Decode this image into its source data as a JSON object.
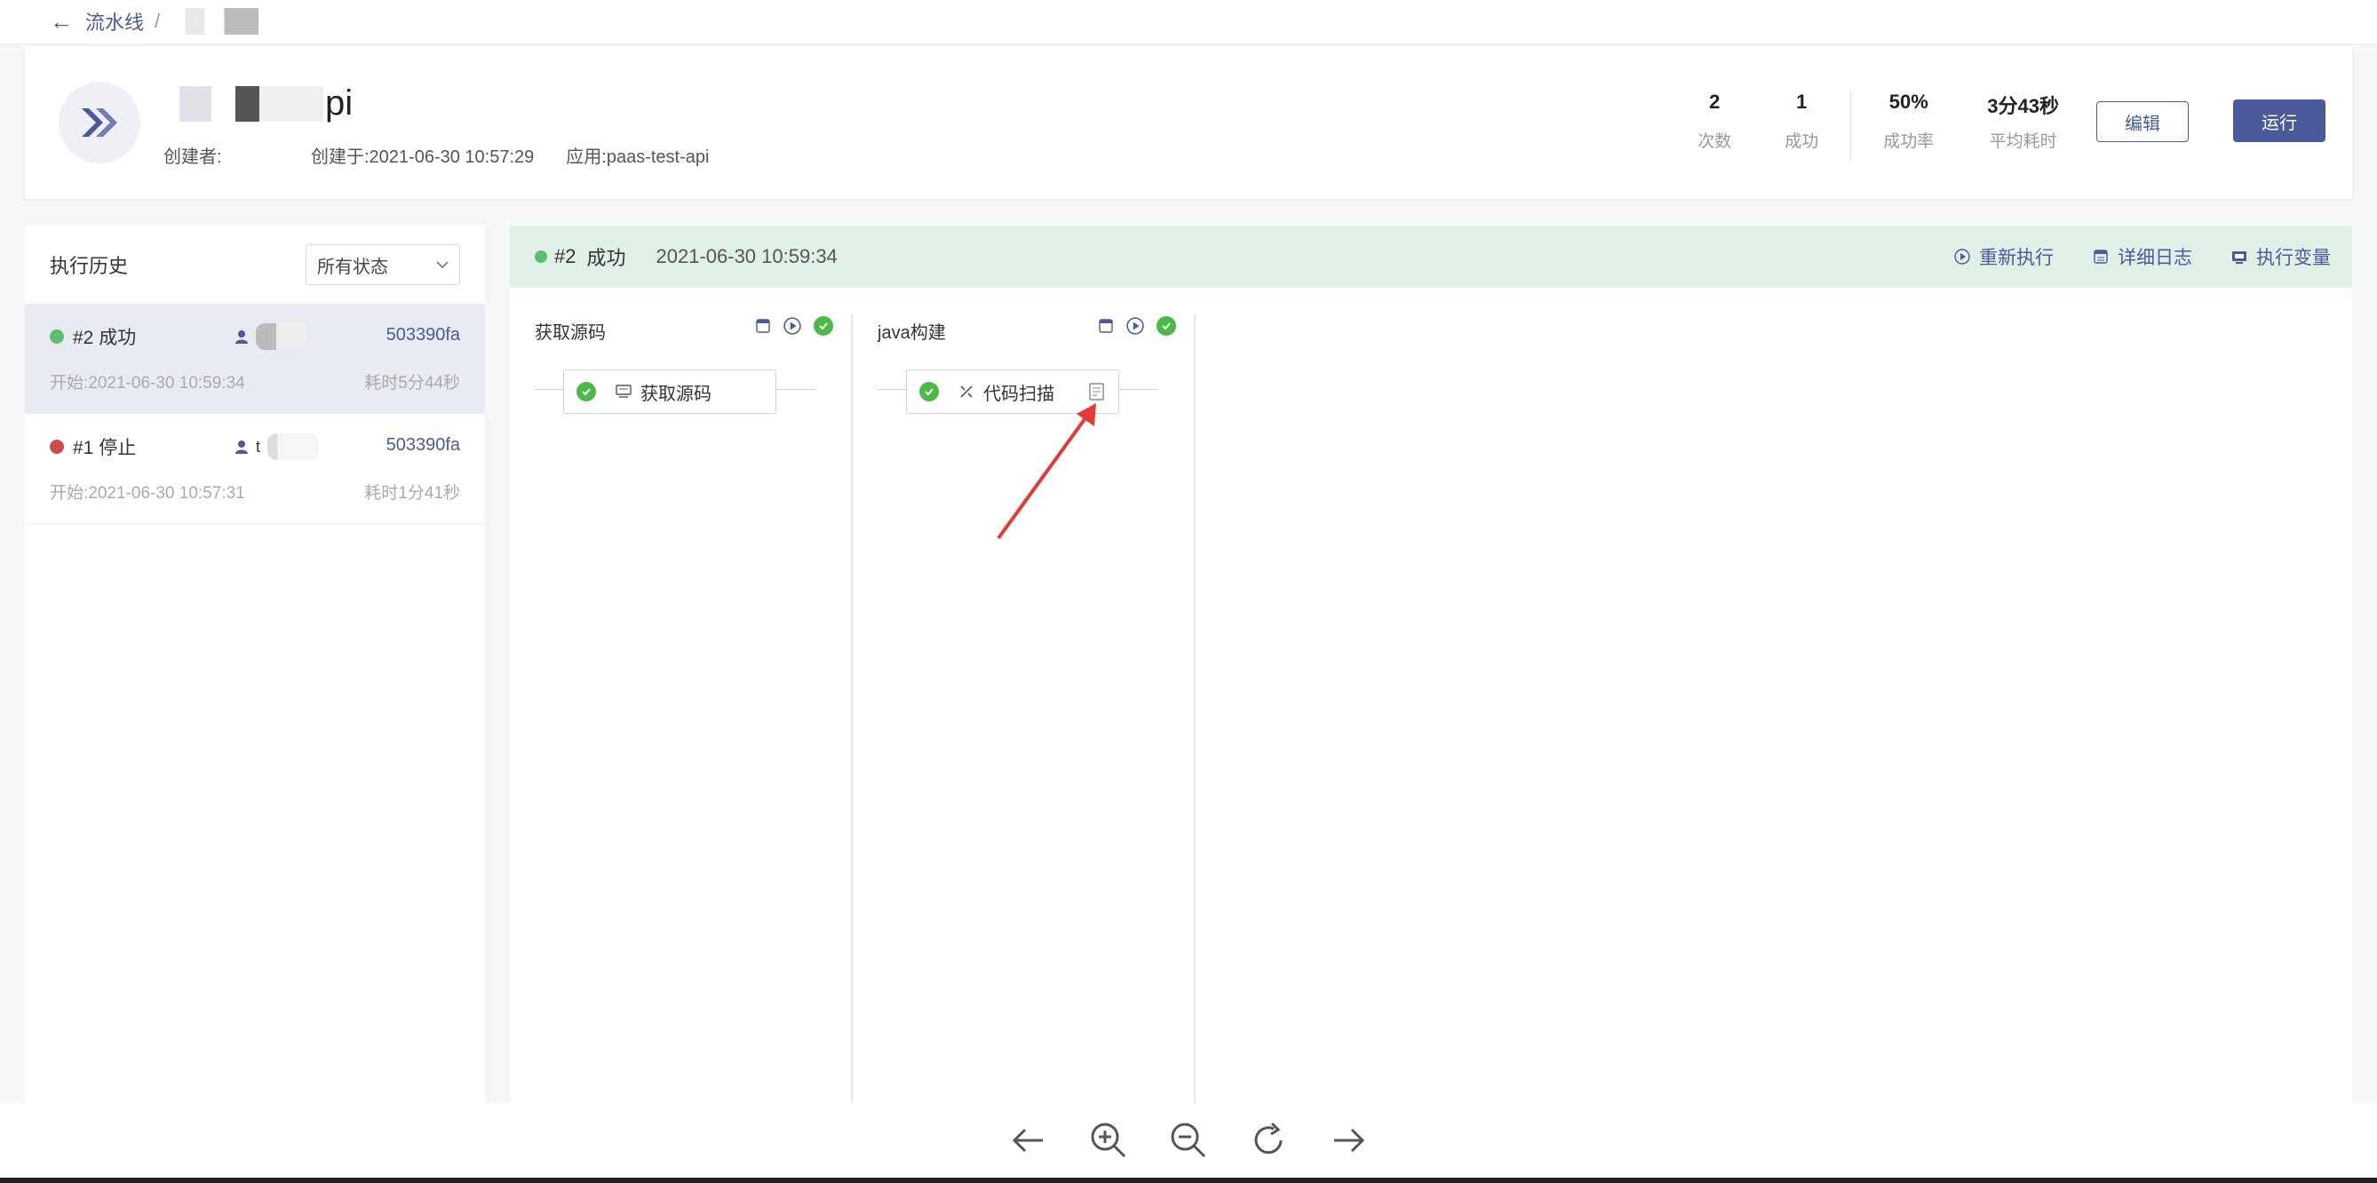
{
  "breadcrumb": {
    "back": "流水线",
    "separator": "/"
  },
  "pipeline": {
    "title_suffix": "pi",
    "creator_label": "创建者:",
    "created_at": "创建于:2021-06-30 10:57:29",
    "app": "应用:paas-test-api"
  },
  "stats": [
    {
      "value": "2",
      "label": "次数"
    },
    {
      "value": "1",
      "label": "成功"
    },
    {
      "value": "50%",
      "label": "成功率"
    },
    {
      "value": "3分43秒",
      "label": "平均耗时"
    }
  ],
  "buttons": {
    "edit": "编辑",
    "run": "运行"
  },
  "history": {
    "title": "执行历史",
    "filter": "所有状态",
    "items": [
      {
        "run": "#2 成功",
        "status_color": "#5cbd6e",
        "commit": "503390fa",
        "start": "开始:2021-06-30 10:59:34",
        "duration": "耗时5分44秒"
      },
      {
        "run": "#1 停止",
        "status_color": "#cc4b4b",
        "commit": "503390fa",
        "start": "开始:2021-06-30 10:57:31",
        "duration": "耗时1分41秒",
        "user_initial": "t"
      }
    ]
  },
  "run_detail": {
    "run": "#2",
    "status": "成功",
    "time": "2021-06-30 10:59:34",
    "actions": {
      "rerun": "重新执行",
      "logs": "详细日志",
      "vars": "执行变量"
    }
  },
  "stages": [
    {
      "name": "获取源码",
      "job": "获取源码"
    },
    {
      "name": "java构建",
      "job": "代码扫描"
    }
  ],
  "colors": {
    "accent": "#4a5a9a",
    "success": "#4cb848",
    "success_bar": "#dff0e6",
    "stopped": "#cc4b4b"
  }
}
